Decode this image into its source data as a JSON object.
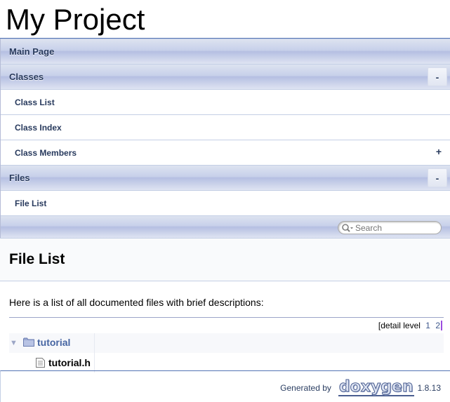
{
  "header": {
    "project_name": "My Project"
  },
  "menu": {
    "main_page": "Main Page",
    "classes": "Classes",
    "classes_toggle": "-",
    "class_list": "Class List",
    "class_index": "Class Index",
    "class_members": "Class Members",
    "class_members_toggle": "+",
    "files": "Files",
    "files_toggle": "-",
    "file_list": "File List"
  },
  "search": {
    "placeholder": "Search",
    "icon": "search-icon"
  },
  "page": {
    "title": "File List",
    "intro": "Here is a list of all documented files with brief descriptions:"
  },
  "detail_level": {
    "label": "[detail level",
    "levels": [
      "1",
      "2"
    ],
    "close": "]"
  },
  "tree": {
    "rows": [
      {
        "name": "tutorial",
        "type": "folder",
        "arrow": "▼"
      },
      {
        "name": "tutorial.h",
        "type": "file"
      }
    ]
  },
  "footer": {
    "generated_by": "Generated by",
    "logo": "doxygen",
    "version": "1.8.13"
  },
  "colors": {
    "accent": "#4665a2",
    "nav_text": "#283a5d",
    "border": "#5373b4"
  }
}
